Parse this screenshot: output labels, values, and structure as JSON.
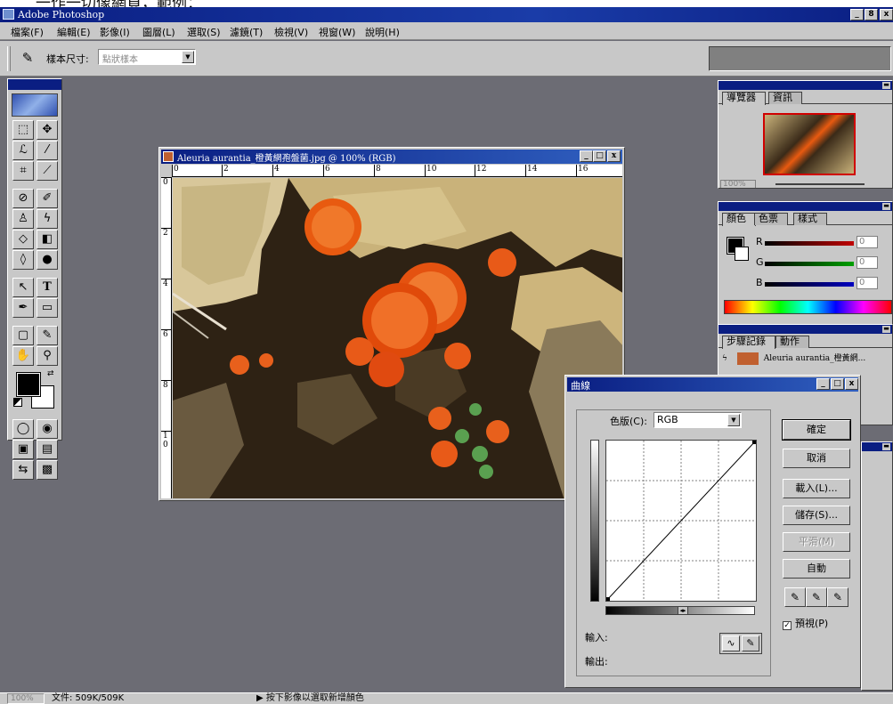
{
  "app": {
    "title": "Adobe Photoshop",
    "window_controls": {
      "minimize": "_",
      "restore": "8",
      "close": "x"
    }
  },
  "menu": [
    "檔案(F)",
    "編輯(E)",
    "影像(I)",
    "圖層(L)",
    "選取(S)",
    "濾鏡(T)",
    "檢視(V)",
    "視窗(W)",
    "說明(H)"
  ],
  "options_bar": {
    "tool_icon": "eyedropper-icon",
    "sample_size_label": "樣本尺寸:",
    "sample_size_value": "點狀樣本"
  },
  "document": {
    "title": "Aleuria aurantia_橙黃網孢盤菌.jpg @ 100% (RGB)",
    "ruler_h": [
      "0",
      "2",
      "4",
      "6",
      "8",
      "10",
      "12",
      "14",
      "16"
    ],
    "ruler_v": [
      "0",
      "2",
      "4",
      "6",
      "8",
      "1 0"
    ]
  },
  "navigator": {
    "tabs": [
      "導覽器",
      "資訊"
    ],
    "zoom": "100%"
  },
  "color_panel": {
    "tabs": [
      "顏色",
      "色票",
      "樣式"
    ],
    "channels": [
      "R",
      "G",
      "B"
    ],
    "values": [
      "0",
      "0",
      "0"
    ],
    "slider_colors": [
      "#c00000",
      "#00a000",
      "#0000c0"
    ]
  },
  "history_panel": {
    "tabs": [
      "步驟記錄",
      "動作"
    ],
    "item": "Aleuria aurantia_橙黃網..."
  },
  "curves_dialog": {
    "title": "曲線",
    "channel_label": "色版(C):",
    "channel_value": "RGB",
    "buttons": {
      "ok": "確定",
      "cancel": "取消",
      "load": "載入(L)...",
      "save": "儲存(S)...",
      "smooth": "平滑(M)",
      "auto": "自動"
    },
    "input_label": "輸入:",
    "output_label": "輸出:",
    "preview_label": "預視(P)",
    "preview_checked": true
  },
  "status": {
    "zoom": "100%",
    "doc_info": "文件: 509K/509K",
    "hint": "▶  按下影像以選取新增顏色"
  }
}
